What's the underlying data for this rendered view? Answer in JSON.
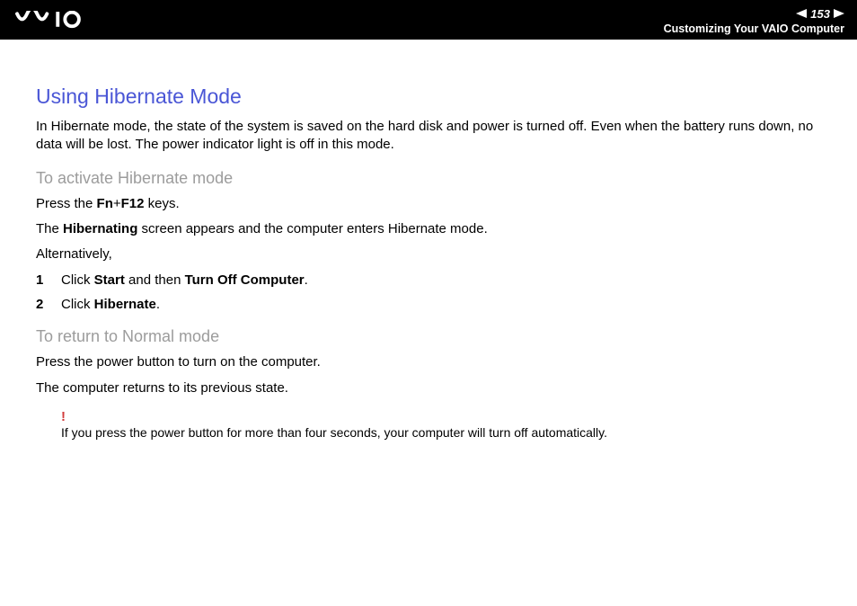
{
  "header": {
    "page_number": "153",
    "breadcrumb": "Customizing Your VAIO Computer"
  },
  "main": {
    "title": "Using Hibernate Mode",
    "intro": "In Hibernate mode, the state of the system is saved on the hard disk and power is turned off. Even when the battery runs down, no data will be lost. The power indicator light is off in this mode.",
    "activate": {
      "heading": "To activate Hibernate mode",
      "press_prefix": "Press the ",
      "key1": "Fn",
      "plus": "+",
      "key2": "F12",
      "press_suffix": " keys.",
      "line2_a": "The ",
      "line2_b": "Hibernating",
      "line2_c": " screen appears and the computer enters Hibernate mode.",
      "alt": "Alternatively,",
      "steps": [
        {
          "n": "1",
          "a": "Click ",
          "b": "Start",
          "c": " and then ",
          "d": "Turn Off Computer",
          "e": "."
        },
        {
          "n": "2",
          "a": "Click ",
          "b": "Hibernate",
          "c": "",
          "d": "",
          "e": "."
        }
      ]
    },
    "return": {
      "heading": "To return to Normal mode",
      "line1": "Press the power button to turn on the computer.",
      "line2": "The computer returns to its previous state."
    },
    "note": {
      "mark": "!",
      "text": "If you press the power button for more than four seconds, your computer will turn off automatically."
    }
  }
}
